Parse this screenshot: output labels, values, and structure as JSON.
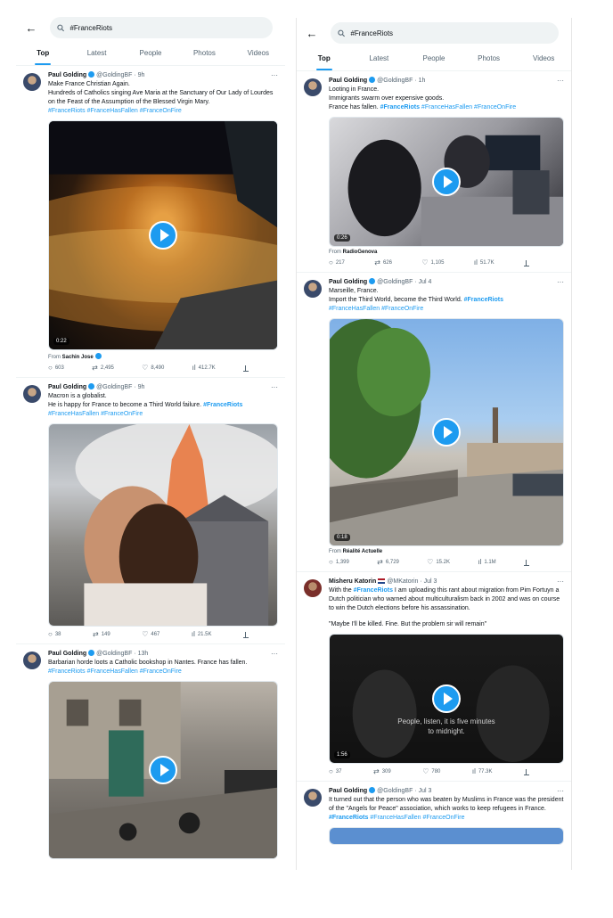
{
  "left": {
    "back_icon": "←",
    "search_value": "#FranceRiots",
    "tabs": [
      "Top",
      "Latest",
      "People",
      "Photos",
      "Videos"
    ],
    "tweets": [
      {
        "name": "Paul Golding",
        "handle": "@GoldingBF",
        "time": "· 9h",
        "text1": "Make France Christian Again.",
        "text2": "Hundreds of Catholics singing Ave Maria at the Sanctuary of Our Lady of Lourdes on the Feast of the Assumption of the Blessed Virgin Mary.",
        "tags": "#FranceRiots #FranceHasFallen #FranceOnFire",
        "duration": "0:22",
        "from_label": "From",
        "from_name": "Sachin Jose",
        "replies": "603",
        "retweets": "2,495",
        "likes": "8,490",
        "views": "412.7K"
      },
      {
        "name": "Paul Golding",
        "handle": "@GoldingBF",
        "time": "· 9h",
        "text1": "Macron is a globalist.",
        "text2": "He is happy for France to become a Third World failure.",
        "tag_inline": "#FranceRiots",
        "tags": "#FranceHasFallen #FranceOnFire",
        "replies": "38",
        "retweets": "149",
        "likes": "467",
        "views": "21.5K"
      },
      {
        "name": "Paul Golding",
        "handle": "@GoldingBF",
        "time": "· 13h",
        "text1": "Barbarian horde loots a Catholic bookshop in Nantes.  France has fallen.",
        "tags": "#FranceRiots #FranceHasFallen #FranceOnFire"
      }
    ]
  },
  "right": {
    "back_icon": "←",
    "search_value": "#FranceRiots",
    "tabs": [
      "Top",
      "Latest",
      "People",
      "Photos",
      "Videos"
    ],
    "tweets": [
      {
        "name": "Paul Golding",
        "handle": "@GoldingBF",
        "time": "· 1h",
        "text1": "Looting in France.",
        "text2": "Immigrants swarm over expensive goods.",
        "text3": "France has fallen.",
        "tag_inline": "#FranceRiots",
        "tags": "#FranceHasFallen #FranceOnFire",
        "duration": "0:26",
        "from_label": "From",
        "from_name": "RadioGenova",
        "replies": "217",
        "retweets": "626",
        "likes": "1,105",
        "views": "51.7K"
      },
      {
        "name": "Paul Golding",
        "handle": "@GoldingBF",
        "time": "· Jul 4",
        "text1": "Marseille, France.",
        "text2": "Import the Third World, become the Third World.",
        "tag_inline": "#FranceRiots",
        "tags": "#FranceHasFallen #FranceOnFire",
        "duration": "0:18",
        "from_label": "From",
        "from_name": "Réalité Actuelle",
        "replies": "1,399",
        "retweets": "6,729",
        "likes": "15.2K",
        "views": "1.1M"
      },
      {
        "name": "Misheru Katorin",
        "handle": "@MKatorin",
        "time": "· Jul 3",
        "text_pre": "With the ",
        "tag_inline": "#FranceRiots",
        "text1": " I am uploading this rant about migration from Pim Fortuyn a  Dutch politician who warned about multiculturalism back in 2002 and was on course to win the Dutch elections before his assassination.",
        "quote": "\"Maybe I'll be killed. Fine. But the problem sir will remain\"",
        "caption1": "People, listen, it is five minutes",
        "caption2": "to midnight.",
        "duration": "1:56",
        "replies": "37",
        "retweets": "309",
        "likes": "780",
        "views": "77.3K"
      },
      {
        "name": "Paul Golding",
        "handle": "@GoldingBF",
        "time": "· Jul 3",
        "text1": "It turned out that the person who was beaten by Muslims in France was the president of the \"Angels for Peace\" association, which works to keep refugees in France.",
        "tag_inline": "#FranceRiots",
        "tags": "#FranceHasFallen #FranceOnFire"
      }
    ]
  }
}
